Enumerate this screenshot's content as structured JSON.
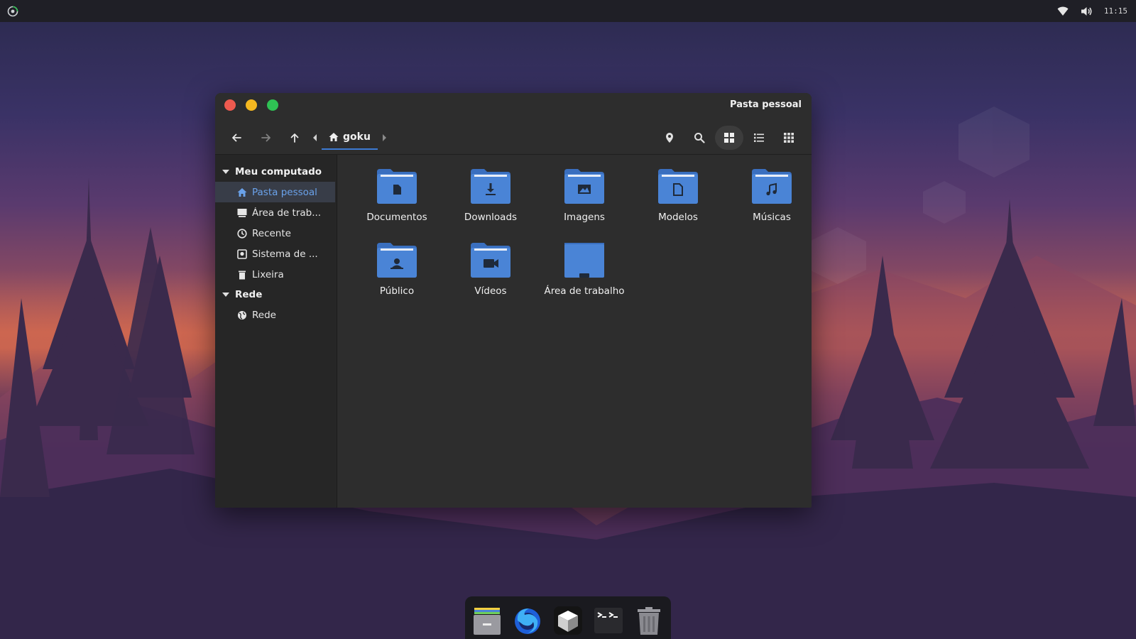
{
  "panel": {
    "clock": "11:15",
    "left_icon": "distro-logo-icon",
    "right_icons": [
      "wifi-icon",
      "volume-icon"
    ]
  },
  "window": {
    "title": "Pasta pessoal",
    "breadcrumb": {
      "label": "goku",
      "icon": "home-icon"
    },
    "nav_icons": [
      "back-icon",
      "forward-icon",
      "up-icon",
      "crumb-left-icon",
      "crumb-right-icon"
    ],
    "tool_icons": [
      "location-icon",
      "search-icon",
      "grid-view-icon",
      "list-view-icon",
      "compact-view-icon"
    ]
  },
  "sidebar": {
    "sections": [
      {
        "title": "Meu computado",
        "items": [
          {
            "label": "Pasta pessoal",
            "icon": "home-icon",
            "selected": true
          },
          {
            "label": "Área de trab...",
            "icon": "desktop-icon"
          },
          {
            "label": "Recente",
            "icon": "clock-icon"
          },
          {
            "label": "Sistema de ...",
            "icon": "disk-icon"
          },
          {
            "label": "Lixeira",
            "icon": "trash-icon"
          }
        ]
      },
      {
        "title": "Rede",
        "items": [
          {
            "label": "Rede",
            "icon": "network-icon"
          }
        ]
      }
    ]
  },
  "files": [
    {
      "name": "Documentos",
      "icon": "folder-documents-icon"
    },
    {
      "name": "Downloads",
      "icon": "folder-downloads-icon"
    },
    {
      "name": "Imagens",
      "icon": "folder-pictures-icon"
    },
    {
      "name": "Modelos",
      "icon": "folder-templates-icon"
    },
    {
      "name": "Músicas",
      "icon": "folder-music-icon"
    },
    {
      "name": "Público",
      "icon": "folder-public-icon"
    },
    {
      "name": "Vídeos",
      "icon": "folder-videos-icon"
    },
    {
      "name": "Área de trabalho",
      "icon": "folder-desktop-icon"
    }
  ],
  "dock": {
    "items": [
      {
        "name": "files-app-icon",
        "running": true
      },
      {
        "name": "firefox-icon",
        "running": true
      },
      {
        "name": "app-center-icon",
        "running": true
      },
      {
        "name": "terminal-icon",
        "running": false
      },
      {
        "name": "trash-dock-icon",
        "running": false
      }
    ]
  },
  "colors": {
    "accent": "#3d7bd4",
    "folder": "#4a84d6",
    "window_bg": "#2d2d2d",
    "sidebar_bg": "#262626",
    "panel_bg": "#1f1f26",
    "close": "#ee5a4f",
    "minimize": "#f5b820",
    "maximize": "#2fc154"
  }
}
